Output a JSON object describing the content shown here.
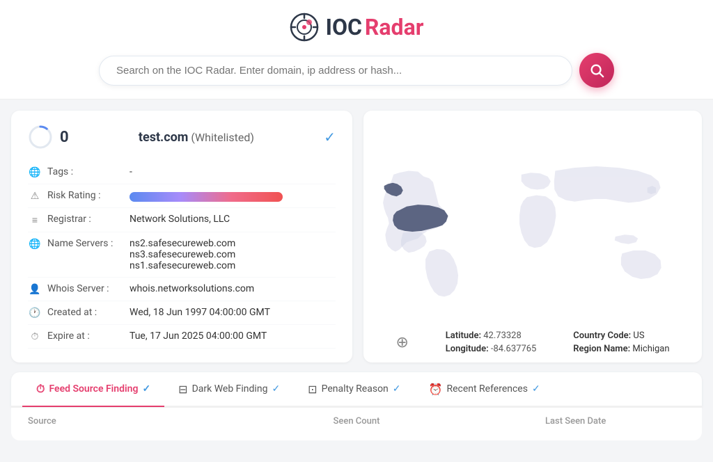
{
  "header": {
    "logo_ioc": "IOC",
    "logo_radar": "Radar",
    "search_placeholder": "Search on the IOC Radar. Enter domain, ip address or hash..."
  },
  "domain_info": {
    "score": "0",
    "name": "test.com",
    "whitelisted": "(Whitelisted)",
    "tags_label": "Tags :",
    "tags_value": "-",
    "risk_label": "Risk Rating :",
    "registrar_label": "Registrar :",
    "registrar_value": "Network Solutions, LLC",
    "nameservers_label": "Name Servers :",
    "nameserver1": "ns2.safesecureweb.com",
    "nameserver2": "ns3.safesecureweb.com",
    "nameserver3": "ns1.safesecureweb.com",
    "whois_label": "Whois Server :",
    "whois_value": "whois.networksolutions.com",
    "created_label": "Created at :",
    "created_value": "Wed, 18 Jun 1997 04:00:00 GMT",
    "expire_label": "Expire at :",
    "expire_value": "Tue, 17 Jun 2025 04:00:00 GMT"
  },
  "map_info": {
    "latitude_label": "Latitude:",
    "latitude_value": "42.73328",
    "longitude_label": "Longitude:",
    "longitude_value": "-84.637765",
    "country_code_label": "Country Code:",
    "country_code_value": "US",
    "region_label": "Region Name:",
    "region_value": "Michigan"
  },
  "tabs": [
    {
      "id": "feed",
      "label": "Feed Source Finding",
      "active": true
    },
    {
      "id": "darkweb",
      "label": "Dark Web Finding",
      "active": false
    },
    {
      "id": "penalty",
      "label": "Penalty Reason",
      "active": false
    },
    {
      "id": "references",
      "label": "Recent References",
      "active": false
    }
  ],
  "table": {
    "columns": [
      "Source",
      "Seen Count",
      "Last Seen Date"
    ]
  }
}
